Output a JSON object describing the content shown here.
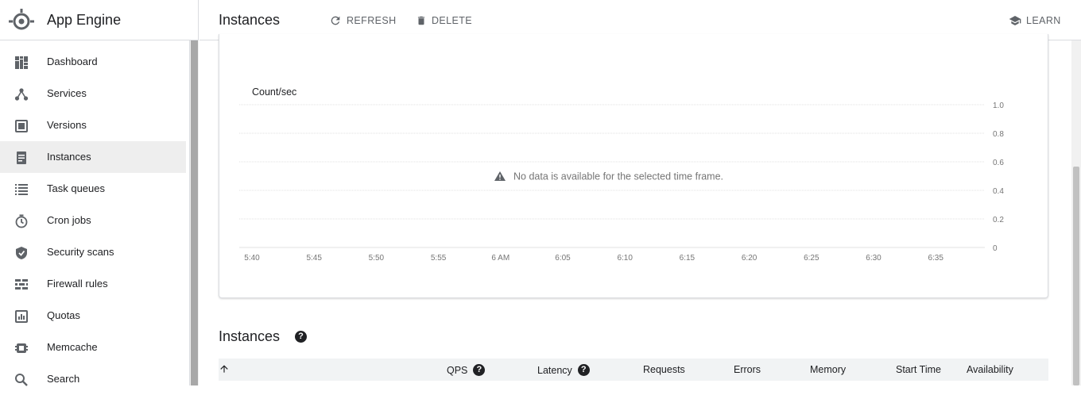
{
  "product": {
    "title": "App Engine",
    "logo_icon": "app-engine-logo"
  },
  "sidebar": {
    "items": [
      {
        "label": "Dashboard",
        "icon": "dashboard-icon",
        "active": false
      },
      {
        "label": "Services",
        "icon": "services-icon",
        "active": false
      },
      {
        "label": "Versions",
        "icon": "versions-icon",
        "active": false
      },
      {
        "label": "Instances",
        "icon": "instances-icon",
        "active": true
      },
      {
        "label": "Task queues",
        "icon": "task-queues-icon",
        "active": false
      },
      {
        "label": "Cron jobs",
        "icon": "cron-jobs-icon",
        "active": false
      },
      {
        "label": "Security scans",
        "icon": "security-scans-icon",
        "active": false
      },
      {
        "label": "Firewall rules",
        "icon": "firewall-rules-icon",
        "active": false
      },
      {
        "label": "Quotas",
        "icon": "quotas-icon",
        "active": false
      },
      {
        "label": "Memcache",
        "icon": "memcache-icon",
        "active": false
      },
      {
        "label": "Search",
        "icon": "search-icon",
        "active": false
      }
    ]
  },
  "toolbar": {
    "title": "Instances",
    "refresh_label": "REFRESH",
    "delete_label": "DELETE",
    "learn_label": "LEARN"
  },
  "chart_data": {
    "type": "line",
    "ylabel": "Count/sec",
    "x_tick_labels": [
      "5:40",
      "5:45",
      "5:50",
      "5:55",
      "6 AM",
      "6:05",
      "6:10",
      "6:15",
      "6:20",
      "6:25",
      "6:30",
      "6:35"
    ],
    "y_tick_labels": [
      "1.0",
      "0.8",
      "0.6",
      "0.4",
      "0.2",
      "0"
    ],
    "ylim": [
      0,
      1.0
    ],
    "grid": true,
    "series": [],
    "empty_message": "No data is available for the selected time frame."
  },
  "instances_section": {
    "title": "Instances",
    "columns": [
      "QPS",
      "Latency",
      "Requests",
      "Errors",
      "Memory",
      "Start Time",
      "Availability"
    ]
  },
  "colors": {
    "accent": "#1a73e8",
    "active_nav_bg": "#eeeeee",
    "table_header_bg": "#f1f3f4"
  }
}
